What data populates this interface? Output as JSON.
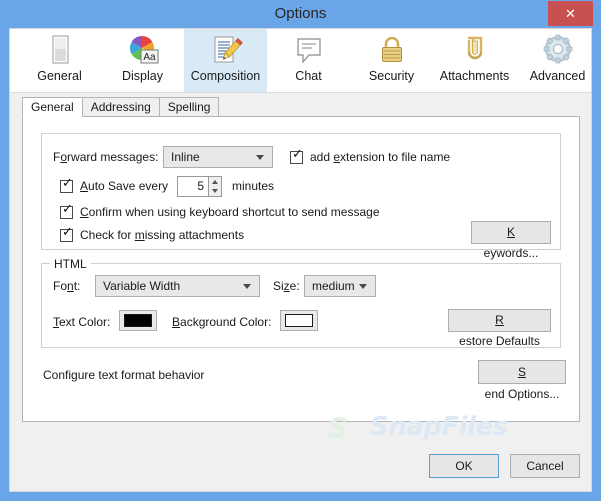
{
  "window": {
    "title": "Options",
    "close_label": "✕"
  },
  "toolbar": {
    "items": [
      {
        "label": "General",
        "icon": "document-page-icon",
        "selected": false
      },
      {
        "label": "Display",
        "icon": "color-wheel-aa-icon",
        "selected": false
      },
      {
        "label": "Composition",
        "icon": "pencil-document-icon",
        "selected": true
      },
      {
        "label": "Chat",
        "icon": "speech-bubble-icon",
        "selected": false
      },
      {
        "label": "Security",
        "icon": "padlock-icon",
        "selected": false
      },
      {
        "label": "Attachments",
        "icon": "paperclip-icon",
        "selected": false
      },
      {
        "label": "Advanced",
        "icon": "gear-icon",
        "selected": false
      }
    ]
  },
  "tabs": [
    {
      "label": "General",
      "active": true
    },
    {
      "label": "Addressing",
      "active": false
    },
    {
      "label": "Spelling",
      "active": false
    }
  ],
  "general_group": {
    "forward_label_pre": "F",
    "forward_label_accel": "o",
    "forward_label_post": "rward messages:",
    "forward_value": "Inline",
    "add_extension": {
      "checked": true,
      "pre": "add ",
      "accel": "e",
      "post": "xtension to file name"
    },
    "auto_save": {
      "checked": true,
      "pre": "",
      "accel": "A",
      "post": "uto Save every",
      "value": "5",
      "unit": "minutes"
    },
    "confirm_shortcut": {
      "checked": true,
      "pre": "",
      "accel": "C",
      "post": "onfirm when using keyboard shortcut to send message"
    },
    "check_attachments": {
      "checked": true,
      "pre": "Check for ",
      "accel": "m",
      "post": "issing attachments"
    },
    "keywords_button": {
      "pre": "",
      "accel": "K",
      "post": "eywords..."
    }
  },
  "html_group": {
    "legend": "HTML",
    "font_label_pre": "Fo",
    "font_label_accel": "n",
    "font_label_post": "t:",
    "font_value": "Variable Width",
    "size_label_pre": "Si",
    "size_label_accel": "z",
    "size_label_post": "e:",
    "size_value": "medium",
    "text_color_label_pre": "",
    "text_color_label_accel": "T",
    "text_color_label_post": "ext Color:",
    "text_color_value": "#000000",
    "bg_color_label_pre": "",
    "bg_color_label_accel": "B",
    "bg_color_label_post": "ackground Color:",
    "bg_color_value": "#ffffff",
    "restore_button": {
      "pre": "",
      "accel": "R",
      "post": "estore Defaults"
    }
  },
  "footer_row": {
    "configure_text": "Configure text format behavior",
    "send_options_button": {
      "pre": "",
      "accel": "S",
      "post": "end Options..."
    }
  },
  "watermark": {
    "mark": "S",
    "text": "SnapFiles"
  },
  "dialog_buttons": {
    "ok": "OK",
    "cancel": "Cancel"
  },
  "colors": {
    "titlebar": "#6aa5e8",
    "close_button": "#c75050",
    "dialog_bg": "#f0f0f0",
    "panel_bg": "#ffffff",
    "tab_selected_bg": "#d9eaf7",
    "focus_border": "#5a9fd4"
  }
}
